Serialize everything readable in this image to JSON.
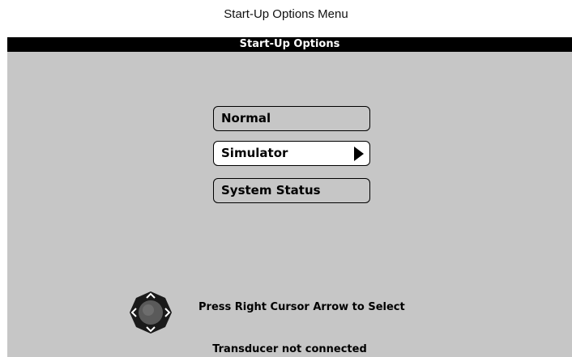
{
  "caption": "Start-Up Options Menu",
  "screen": {
    "title": "Start-Up Options",
    "menu": [
      {
        "label": "Normal",
        "selected": false
      },
      {
        "label": "Simulator",
        "selected": true,
        "icon": "right-arrow-icon"
      },
      {
        "label": "System Status",
        "selected": false
      }
    ],
    "cursor_pad_icon": "four-way-cursor-pad-icon",
    "instruction": "Press Right Cursor Arrow to Select",
    "status": "Transducer not connected"
  },
  "colors": {
    "screen_background": "#c6c6c6",
    "titlebar": "#000000",
    "selected_item": "#ffffff"
  }
}
